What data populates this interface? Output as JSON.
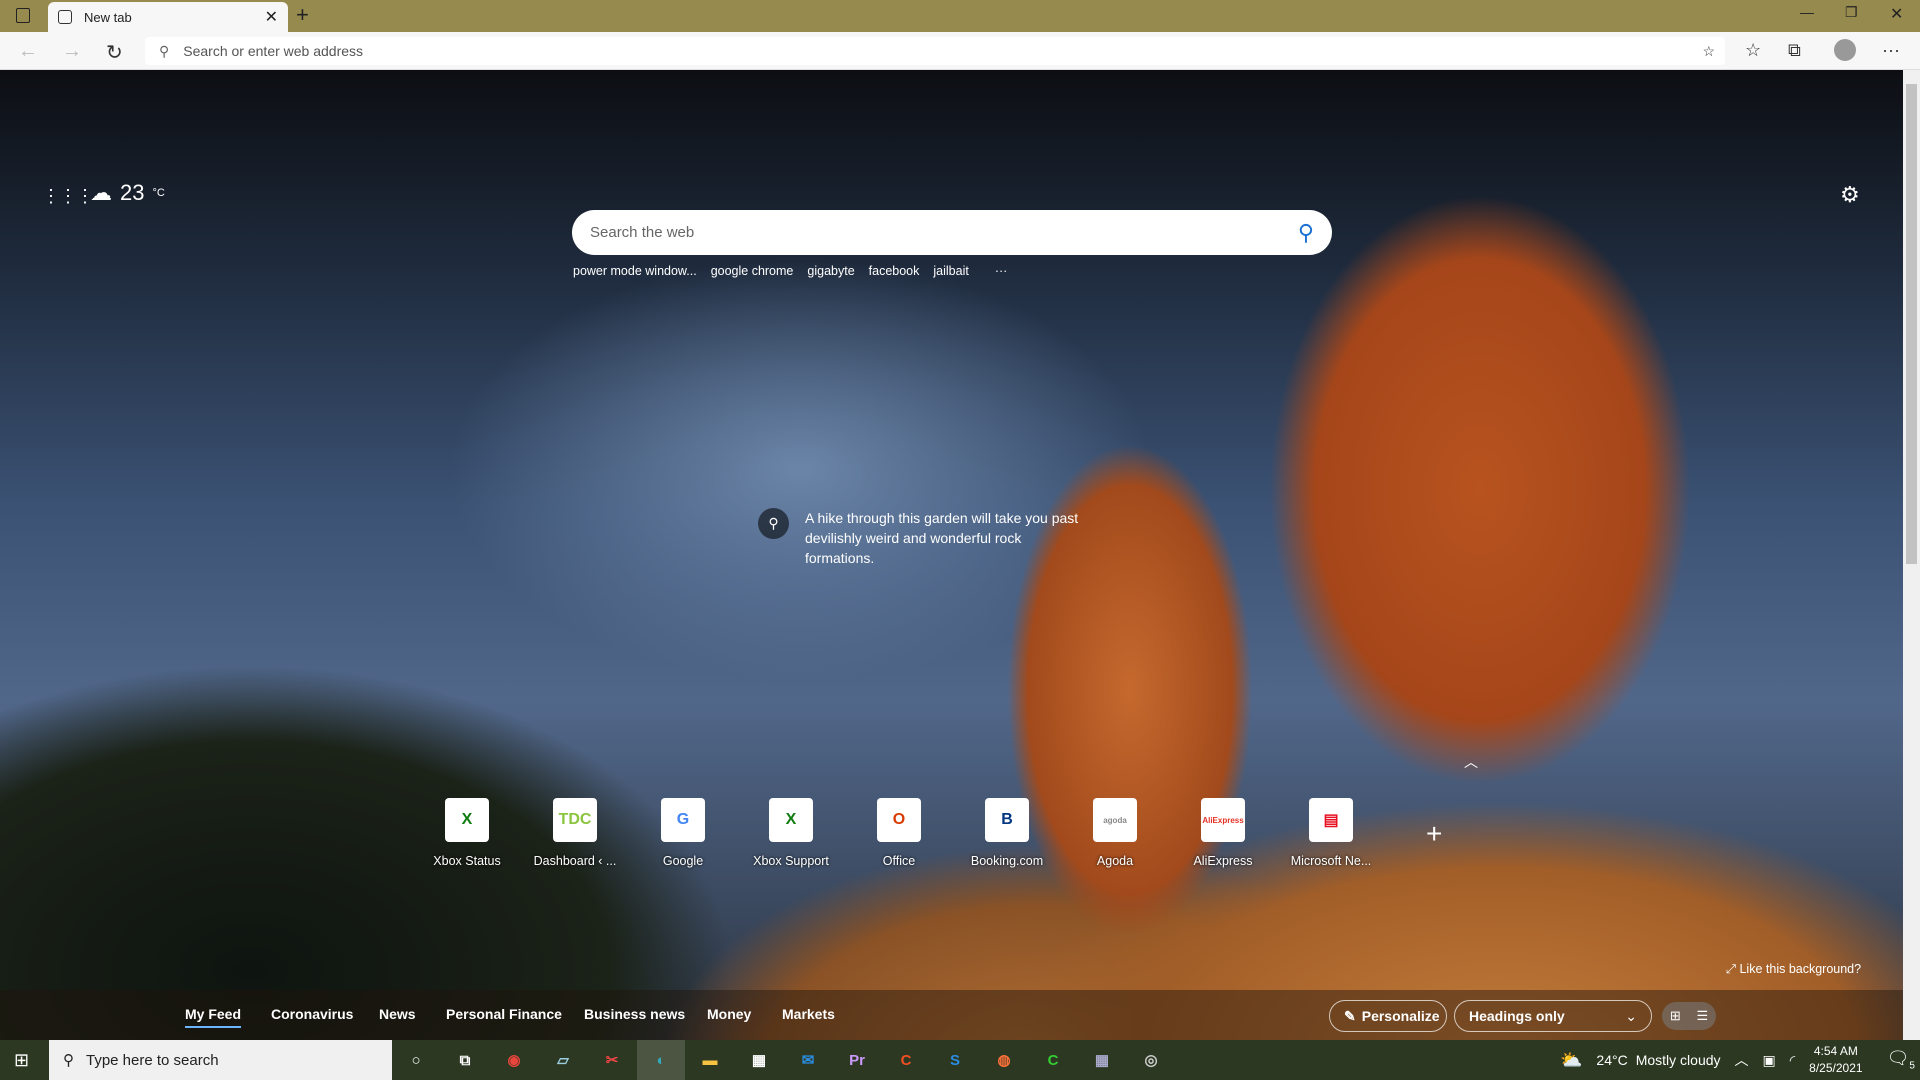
{
  "browser": {
    "tab_title": "New tab",
    "address_placeholder": "Search or enter web address"
  },
  "weather": {
    "temp": "23",
    "unit": "°C"
  },
  "search": {
    "placeholder": "Search the web",
    "suggestions": [
      "power mode window...",
      "google chrome",
      "gigabyte",
      "facebook",
      "jailbait"
    ],
    "more": "···"
  },
  "image_info": "A hike through this garden will take you past devilishly weird and wonderful rock formations.",
  "quick_links": [
    {
      "label": "Xbox Status",
      "glyph": "X",
      "color": "#107c10"
    },
    {
      "label": "Dashboard ‹ ...",
      "glyph": "TDC",
      "color": "#8bc53f"
    },
    {
      "label": "Google",
      "glyph": "G",
      "color": "#4285f4"
    },
    {
      "label": "Xbox Support",
      "glyph": "X",
      "color": "#107c10"
    },
    {
      "label": "Office",
      "glyph": "O",
      "color": "#d83b01"
    },
    {
      "label": "Booking.com",
      "glyph": "B",
      "color": "#003580"
    },
    {
      "label": "Agoda",
      "glyph": "agoda",
      "color": "#888888"
    },
    {
      "label": "AliExpress",
      "glyph": "AliExpress",
      "color": "#e43225"
    },
    {
      "label": "Microsoft Ne...",
      "glyph": "▤",
      "color": "#e81123"
    }
  ],
  "like_background": "Like this background?",
  "feed": {
    "tabs": [
      "My Feed",
      "Coronavirus",
      "News",
      "Personal Finance",
      "Business news",
      "Money",
      "Markets"
    ],
    "personalize": "Personalize",
    "layout_select": "Headings only"
  },
  "taskbar": {
    "search_placeholder": "Type here to search",
    "weather_temp": "24°C",
    "weather_text": "Mostly cloudy",
    "time": "4:54 AM",
    "date": "8/25/2021",
    "notifications": "5"
  }
}
